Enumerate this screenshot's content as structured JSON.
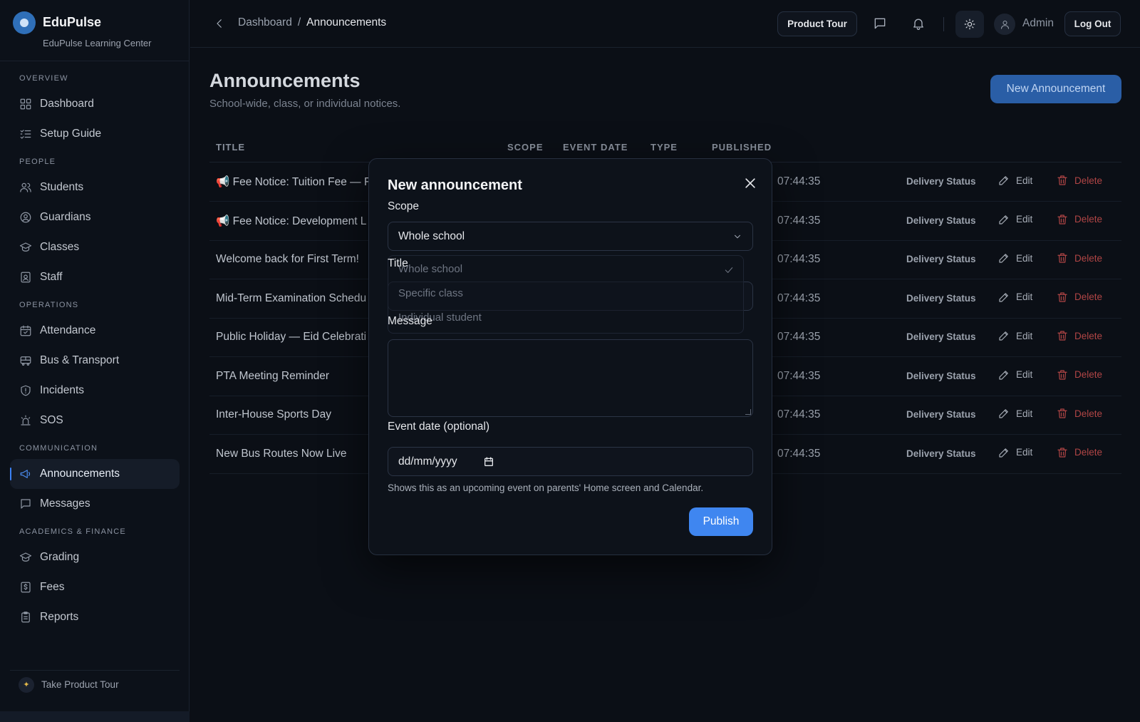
{
  "brand": {
    "name": "EduPulse",
    "subtitle": "EduPulse Learning Center"
  },
  "sidebar": {
    "groups": [
      {
        "title": "OVERVIEW",
        "items": [
          {
            "label": "Dashboard",
            "icon": "grid-icon"
          },
          {
            "label": "Setup Guide",
            "icon": "checklist-icon"
          }
        ]
      },
      {
        "title": "PEOPLE",
        "items": [
          {
            "label": "Students",
            "icon": "users-icon"
          },
          {
            "label": "Guardians",
            "icon": "user-circle-icon"
          },
          {
            "label": "Classes",
            "icon": "graduation-cap-icon"
          },
          {
            "label": "Staff",
            "icon": "id-badge-icon"
          }
        ]
      },
      {
        "title": "OPERATIONS",
        "items": [
          {
            "label": "Attendance",
            "icon": "calendar-check-icon"
          },
          {
            "label": "Bus & Transport",
            "icon": "bus-icon"
          },
          {
            "label": "Incidents",
            "icon": "shield-icon"
          },
          {
            "label": "SOS",
            "icon": "siren-icon"
          }
        ]
      },
      {
        "title": "COMMUNICATION",
        "items": [
          {
            "label": "Announcements",
            "icon": "megaphone-icon",
            "active": true
          },
          {
            "label": "Messages",
            "icon": "message-icon"
          }
        ]
      },
      {
        "title": "ACADEMICS & FINANCE",
        "items": [
          {
            "label": "Grading",
            "icon": "graduation-cap-icon"
          },
          {
            "label": "Fees",
            "icon": "dollar-doc-icon"
          },
          {
            "label": "Reports",
            "icon": "clipboard-icon"
          }
        ]
      }
    ],
    "footer_tour": "Take Product Tour"
  },
  "header": {
    "breadcrumb_parent": "Dashboard",
    "breadcrumb_sep": "/",
    "breadcrumb_current": "Announcements",
    "product_tour": "Product Tour",
    "user": "Admin",
    "logout": "Log Out"
  },
  "page": {
    "title": "Announcements",
    "subtitle": "School-wide, class, or individual notices.",
    "new_button": "New Announcement"
  },
  "table": {
    "columns": [
      "TITLE",
      "SCOPE",
      "EVENT DATE",
      "TYPE",
      "PUBLISHED"
    ],
    "rows": [
      {
        "title": "📢 Fee Notice: Tuition Fee — F",
        "time": "07:44:35"
      },
      {
        "title": "📢 Fee Notice: Development L",
        "time": "07:44:35"
      },
      {
        "title": "Welcome back for First Term!",
        "time": "07:44:35"
      },
      {
        "title": "Mid-Term Examination Schedu",
        "time": "07:44:35"
      },
      {
        "title": "Public Holiday — Eid Celebrati",
        "time": "07:44:35"
      },
      {
        "title": "PTA Meeting Reminder",
        "time": "07:44:35"
      },
      {
        "title": "Inter-House Sports Day",
        "time": "07:44:35"
      },
      {
        "title": "New Bus Routes Now Live",
        "time": "07:44:35"
      }
    ],
    "delivery_status": "Delivery Status",
    "edit": "Edit",
    "delete": "Delete"
  },
  "modal": {
    "title": "New announcement",
    "scope_label": "Scope",
    "scope_value": "Whole school",
    "scope_options": [
      "Whole school",
      "Specific class",
      "Individual student"
    ],
    "title_label": "Title",
    "message_label": "Message",
    "event_label": "Event date (optional)",
    "event_placeholder": "dd/mm/yyyy",
    "hint": "Shows this as an upcoming event on parents' Home screen and Calendar.",
    "publish": "Publish"
  },
  "colors": {
    "accent": "#3f86f0",
    "danger": "#b04545",
    "background": "#0b0f16"
  }
}
